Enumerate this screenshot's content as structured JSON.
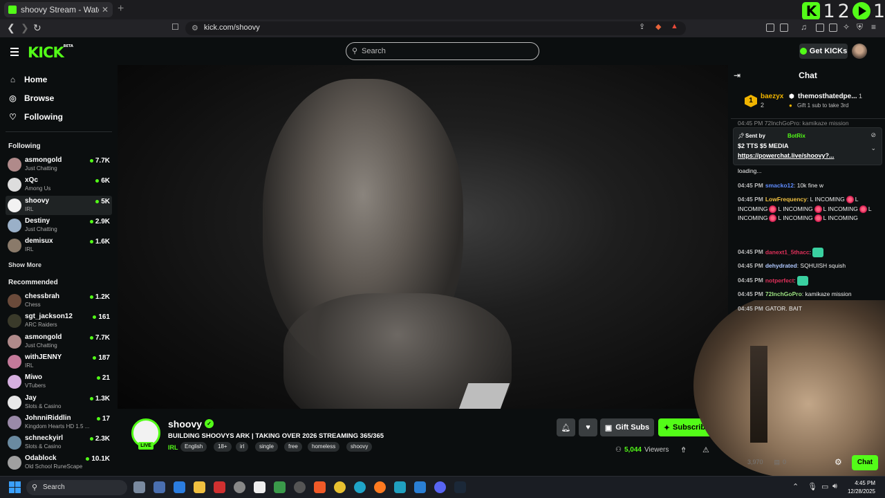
{
  "browser": {
    "tab_title": "shoovy Stream - Watch Live o",
    "url": "kick.com/shoovy",
    "overlay_counter": [
      "1",
      "2",
      "1"
    ]
  },
  "header": {
    "logo": "KICK",
    "logo_beta": "BETA",
    "search_placeholder": "Search",
    "get_kicks_label": "Get KICKs"
  },
  "sidebar": {
    "nav": [
      {
        "label": "Home",
        "icon": "home-icon"
      },
      {
        "label": "Browse",
        "icon": "compass-icon"
      },
      {
        "label": "Following",
        "icon": "heart-icon"
      }
    ],
    "following_heading": "Following",
    "following": [
      {
        "name": "asmongold",
        "category": "Just Chatting",
        "viewers": "7.7K",
        "color": "#b08a8a"
      },
      {
        "name": "xQc",
        "category": "Among Us",
        "viewers": "6K",
        "color": "#dddddd"
      },
      {
        "name": "shoovy",
        "category": "IRL",
        "viewers": "5K",
        "color": "#f2f2f2",
        "active": true
      },
      {
        "name": "Destiny",
        "category": "Just Chatting",
        "viewers": "2.9K",
        "color": "#9ab0c8"
      },
      {
        "name": "demisux",
        "category": "IRL",
        "viewers": "1.6K",
        "color": "#8a7a6a"
      }
    ],
    "show_more": "Show More",
    "recommended_heading": "Recommended",
    "recommended": [
      {
        "name": "chessbrah",
        "category": "Chess",
        "viewers": "1.2K",
        "color": "#6a4a3a"
      },
      {
        "name": "sgt_jackson12",
        "category": "ARC Raiders",
        "viewers": "161",
        "color": "#3a3a2a"
      },
      {
        "name": "asmongold",
        "category": "Just Chatting",
        "viewers": "7.7K",
        "color": "#b08a8a"
      },
      {
        "name": "withJENNY",
        "category": "IRL",
        "viewers": "187",
        "color": "#c47a9a"
      },
      {
        "name": "Miwo",
        "category": "VTubers",
        "viewers": "21",
        "color": "#d6b0e0"
      },
      {
        "name": "Jay",
        "category": "Slots & Casino",
        "viewers": "1.3K",
        "color": "#e8e8e8"
      },
      {
        "name": "JohnniRiddlin",
        "category": "Kingdom Hearts HD 1.5 ...",
        "viewers": "17",
        "color": "#9a8aa8"
      },
      {
        "name": "schneckyirl",
        "category": "Slots & Casino",
        "viewers": "2.3K",
        "color": "#6a8aa0"
      },
      {
        "name": "Odablock",
        "category": "Old School RuneScape",
        "viewers": "10.1K",
        "color": "#a0a0a0"
      }
    ]
  },
  "stream": {
    "channel": "shoovy",
    "live_badge": "LIVE",
    "title": "BUILDING SHOOVYS ARK | TAKING OVER 2026 STREAMING 365/365",
    "category": "IRL",
    "tags": [
      "English",
      "18+",
      "irl",
      "single",
      "free",
      "homeless",
      "shoovy"
    ],
    "gift_subs_label": "Gift Subs",
    "subscribe_label": "Subscribe",
    "viewer_count": "5,044",
    "viewers_label": "Viewers"
  },
  "chat": {
    "title": "Chat",
    "top_gifters": {
      "rank": "1",
      "first": "baezyx",
      "first_count": "2",
      "second": "themosthatedpe...",
      "second_count": "1",
      "prompt": "Gift 1 sub to take 3rd"
    },
    "pinned": {
      "sent_by_label": "Sent by",
      "sender": "BotRix",
      "line1": "$2 TTS $5 MEDIA",
      "line2": "https://powerchat.live/shoovy?..."
    },
    "partial_top": "04:45 PM 72InchGoPro: kamikaze mission",
    "loading": "loading...",
    "messages": [
      {
        "time": "04:45 PM",
        "user": "smacko12",
        "color": "#5f8cff",
        "text": "10k fine w"
      },
      {
        "time": "04:45 PM",
        "user": "LowFrequency",
        "color": "#f0c040",
        "text": "L INCOMING",
        "emotes": true
      },
      {
        "time": "04:45 PM",
        "user": "danext1_5thacc",
        "color": "#e0305a",
        "text": ""
      },
      {
        "time": "04:45 PM",
        "user": "dehydrated",
        "color": "#b0c8ff",
        "text": "SQHUISH squish"
      },
      {
        "time": "04:45 PM",
        "user": "notperfect",
        "color": "#e0305a",
        "text": ""
      },
      {
        "time": "04:45 PM",
        "user": "72InchGoPro",
        "color": "#9be080",
        "text": "kamikaze mission"
      },
      {
        "time": "04:45 PM",
        "user": "",
        "color": "#999999",
        "text": "GATOR. BAIT"
      }
    ],
    "kicks_count": "3,970",
    "zero": "0",
    "chat_button": "Chat"
  },
  "taskbar": {
    "search_placeholder": "Search",
    "time": "4:45 PM",
    "date": "12/28/2025"
  },
  "colors": {
    "accent": "#53fc18",
    "background": "#0b0e0f"
  }
}
